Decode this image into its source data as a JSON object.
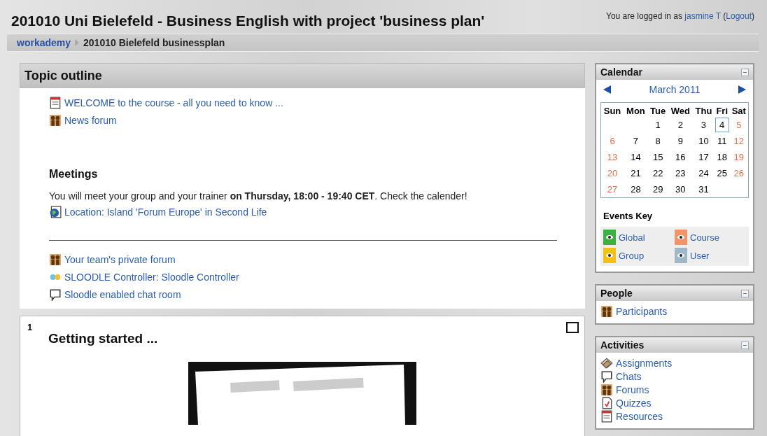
{
  "header": {
    "title": "201010 Uni Bielefeld - Business English with project 'business plan'",
    "login_prefix": "You are logged in as",
    "user": "jasmine T",
    "logout": "Logout",
    "brackets": [
      "(",
      ")"
    ]
  },
  "breadcrumb": [
    {
      "label": "workademy",
      "kind": "link"
    },
    {
      "label": "201010 Bielefeld businessplan",
      "kind": "current"
    }
  ],
  "topic_outline": {
    "title": "Topic outline",
    "items": [
      {
        "kind": "resource",
        "label": "WELCOME to the course - all you need to know ..."
      },
      {
        "kind": "forum",
        "label": "News forum"
      },
      {
        "kind": "heading",
        "label": "Meetings"
      },
      {
        "kind": "text",
        "label": "You will meet your group and your trainer **on Thursday, 18:00 - 19:40 CET**. Check the calender!"
      },
      {
        "kind": "globe",
        "label": "Location: Island 'Forum Europe' in Second Life"
      },
      {
        "kind": "rule"
      },
      {
        "kind": "forum",
        "label": "Your team's private forum"
      },
      {
        "kind": "sloodle",
        "label": "SLOODLE Controller: Sloodle Controller"
      },
      {
        "kind": "chat",
        "label": "Sloodle enabled chat room"
      }
    ]
  },
  "section": {
    "number": "1",
    "title": "Getting started ...",
    "checked": false
  },
  "calendar": {
    "title": "Calendar",
    "month": "March 2011",
    "weekdays": [
      "Sun",
      "Mon",
      "Tue",
      "Wed",
      "Thu",
      "Fri",
      "Sat"
    ],
    "weeks": [
      {
        "kind": "first",
        "days": [
          {
            "day": "1",
            "today": false
          },
          {
            "day": "2",
            "today": false
          },
          {
            "day": "3",
            "today": false
          },
          {
            "day": "4",
            "today": true
          },
          {
            "day": "5",
            "today": false
          }
        ]
      },
      {
        "kind": "full",
        "days": [
          {
            "day": "6",
            "today": false
          },
          {
            "day": "7",
            "today": false
          },
          {
            "day": "8",
            "today": false
          },
          {
            "day": "9",
            "today": false
          },
          {
            "day": "10",
            "today": false
          },
          {
            "day": "11",
            "today": false
          },
          {
            "day": "12",
            "today": false
          }
        ]
      },
      {
        "kind": "full",
        "days": [
          {
            "day": "13",
            "today": false
          },
          {
            "day": "14",
            "today": false
          },
          {
            "day": "15",
            "today": false
          },
          {
            "day": "16",
            "today": false
          },
          {
            "day": "17",
            "today": false
          },
          {
            "day": "18",
            "today": false
          },
          {
            "day": "19",
            "today": false
          }
        ]
      },
      {
        "kind": "full",
        "days": [
          {
            "day": "20",
            "today": false
          },
          {
            "day": "21",
            "today": false
          },
          {
            "day": "22",
            "today": false
          },
          {
            "day": "23",
            "today": false
          },
          {
            "day": "24",
            "today": false
          },
          {
            "day": "25",
            "today": false
          },
          {
            "day": "26",
            "today": false
          }
        ]
      },
      {
        "kind": "last",
        "days": [
          {
            "day": "27",
            "today": false
          },
          {
            "day": "28",
            "today": false
          },
          {
            "day": "29",
            "today": false
          },
          {
            "day": "30",
            "today": false
          },
          {
            "day": "31",
            "today": false
          }
        ]
      }
    ],
    "events_key_title": "Events Key",
    "events_key": [
      {
        "label": "Global",
        "color": "#3cb043"
      },
      {
        "label": "Course",
        "color": "#f0956a"
      },
      {
        "label": "Group",
        "color": "#f5c016"
      },
      {
        "label": "User",
        "color": "#9fb8c8"
      }
    ]
  },
  "people": {
    "title": "People",
    "items": [
      {
        "kind": "forum",
        "label": "Participants"
      }
    ]
  },
  "activities": {
    "title": "Activities",
    "items": [
      {
        "kind": "assignment",
        "label": "Assignments"
      },
      {
        "kind": "chat",
        "label": "Chats"
      },
      {
        "kind": "forum",
        "label": "Forums"
      },
      {
        "kind": "quiz",
        "label": "Quizzes"
      },
      {
        "kind": "resource",
        "label": "Resources"
      }
    ]
  }
}
